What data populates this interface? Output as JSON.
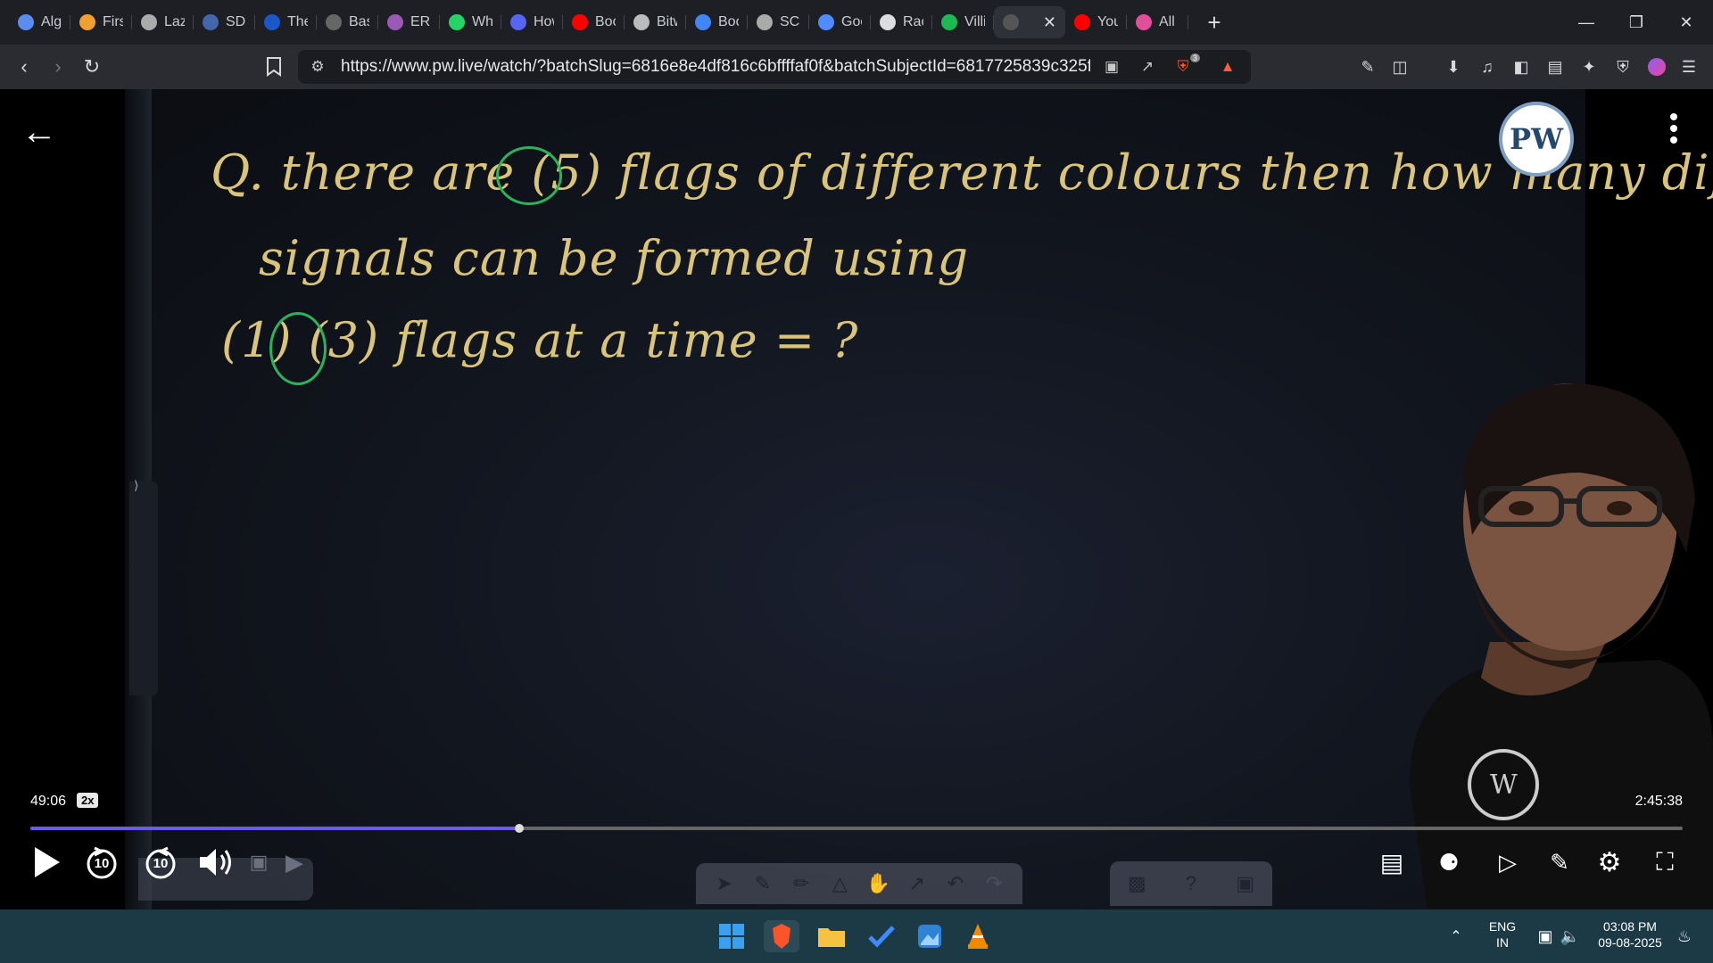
{
  "browser": {
    "tabs": [
      {
        "title": "Alg",
        "icon": "globe-icon",
        "color": "#5b8def"
      },
      {
        "title": "First",
        "icon": "lightning-icon",
        "color": "#f0a030"
      },
      {
        "title": "Lazy",
        "icon": "globe-icon",
        "color": "#aaaaaa"
      },
      {
        "title": "SDL",
        "icon": "book-icon",
        "color": "#4466aa"
      },
      {
        "title": "The",
        "icon": "w3-icon",
        "color": "#1a58c9"
      },
      {
        "title": "Basi",
        "icon": "bar-icon",
        "color": "#666666"
      },
      {
        "title": "ERR",
        "icon": "brain-icon",
        "color": "#9b59b6"
      },
      {
        "title": "Wha",
        "icon": "whatsapp-icon",
        "color": "#25d366"
      },
      {
        "title": "How",
        "icon": "bookmark-icon",
        "color": "#5865f2"
      },
      {
        "title": "Boo",
        "icon": "youtube-icon",
        "color": "#ff0000"
      },
      {
        "title": "Bitw",
        "icon": "bitwise-icon",
        "color": "#bbbbbb"
      },
      {
        "title": "Boo",
        "icon": "google-icon",
        "color": "#4285f4"
      },
      {
        "title": "SCII",
        "icon": "globe-icon",
        "color": "#aaaaaa"
      },
      {
        "title": "Goo",
        "icon": "gemini-icon",
        "color": "#4e8cff"
      },
      {
        "title": "Rac",
        "icon": "chatgpt-icon",
        "color": "#dddddd"
      },
      {
        "title": "Villi",
        "icon": "spotify-icon",
        "color": "#1db954"
      },
      {
        "title": "",
        "icon": "pw-tab-icon",
        "color": "#555555",
        "active": true
      },
      {
        "title": "You",
        "icon": "youtube-icon",
        "color": "#ff0000"
      },
      {
        "title": "All I",
        "icon": "m-icon",
        "color": "#e14f9b"
      }
    ],
    "new_tab_label": "+",
    "url": "https://www.pw.live/watch/?batchSlug=6816e8e4df816c6bffffaf0f&batchSubjectId=6817725839c325f3224...",
    "shield_badge": "3"
  },
  "board": {
    "line1": "Q. there are (5) flags of different colours then how many different",
    "line2": "signals can be formed using",
    "line3": "(1) (3) flags at a time = ?",
    "logo": "PW"
  },
  "player": {
    "current_time": "49:06",
    "speed": "2x",
    "total_time": "2:45:38",
    "progress_fraction": 0.296,
    "rewind_label": "10",
    "forward_label": "10"
  },
  "taskbar": {
    "lang_line1": "ENG",
    "lang_line2": "IN",
    "time": "03:08 PM",
    "date": "09-08-2025"
  }
}
